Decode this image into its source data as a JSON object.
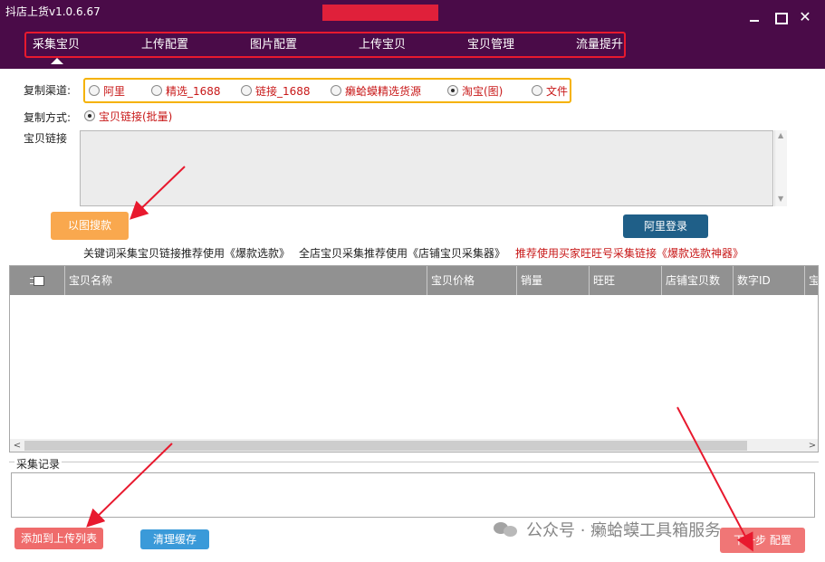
{
  "app": {
    "title": "抖店上货v1.0.6.67",
    "window_controls": {
      "minimize": "minimize-icon",
      "maximize": "maximize-icon",
      "close": "close-icon"
    }
  },
  "nav": {
    "tabs": [
      {
        "label": "采集宝贝",
        "active": true
      },
      {
        "label": "上传配置"
      },
      {
        "label": "图片配置"
      },
      {
        "label": "上传宝贝"
      },
      {
        "label": "宝贝管理"
      },
      {
        "label": "流量提升"
      }
    ]
  },
  "form": {
    "channel_label": "复制渠道:",
    "channels": [
      {
        "label": "阿里",
        "selected": false
      },
      {
        "label": "精选_1688",
        "selected": false
      },
      {
        "label": "链接_1688",
        "selected": false
      },
      {
        "label": "癞蛤蟆精选货源",
        "selected": false
      },
      {
        "label": "淘宝(图)",
        "selected": true
      },
      {
        "label": "文件",
        "selected": false
      }
    ],
    "method_label": "复制方式:",
    "method_option": "宝贝链接(批量)",
    "link_label": "宝贝链接",
    "link_value": ""
  },
  "buttons": {
    "image_search": "以图搜款",
    "ali_login": "阿里登录",
    "add_to_upload": "添加到上传列表",
    "clear_cache": "清理缓存",
    "next_step": "下一步 配置"
  },
  "hints": {
    "keyword": "关键词采集宝贝链接推荐使用《爆款选款》",
    "shop": "全店宝贝采集推荐使用《店铺宝贝采集器》",
    "recommend": "推荐使用买家旺旺号采集链接《爆款选款神器》"
  },
  "table": {
    "columns": [
      "宝贝名称",
      "宝贝价格",
      "销量",
      "旺旺",
      "店铺宝贝数",
      "数字ID",
      "宝"
    ],
    "rows": []
  },
  "log": {
    "title": "采集记录",
    "content": ""
  },
  "watermark": {
    "text": "公众号 · 癞蛤蟆工具箱服务"
  },
  "colors": {
    "titlebar": "#4a0b48",
    "nav_outline": "#e8192e",
    "channel_outline": "#f5b200",
    "red_text": "#c81818",
    "image_search_button": "#f9a84e",
    "ali_login_button": "#1f5f88",
    "pink_button": "#ef6b6b",
    "blue_button": "#3a9ad9",
    "table_header": "#919191"
  }
}
